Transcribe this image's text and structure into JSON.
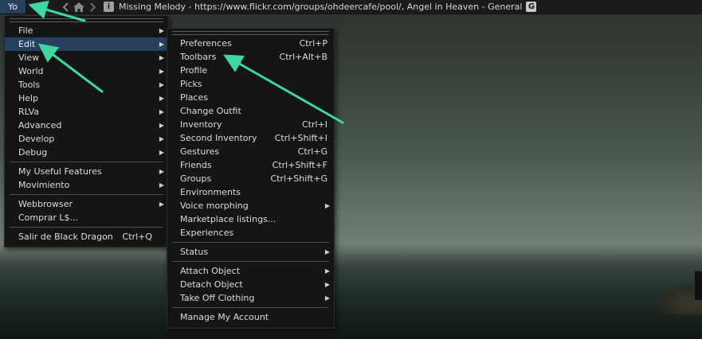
{
  "topbar": {
    "menu_label": "Yo",
    "back_icon": "back-arrow-icon",
    "forward_icon": "forward-arrow-icon",
    "home_icon": "home-icon",
    "info_icon_glyph": "i",
    "location_text": "Missing Melody - https://www.flickr.com/groups/ohdeercafe/pool/, Angel in Heaven - General",
    "rating_badge": "G"
  },
  "main_menu": {
    "items": [
      {
        "label": "File"
      },
      {
        "label": "Edit"
      },
      {
        "label": "View"
      },
      {
        "label": "World"
      },
      {
        "label": "Tools"
      },
      {
        "label": "Help"
      },
      {
        "label": "RLVa"
      },
      {
        "label": "Advanced"
      },
      {
        "label": "Develop"
      },
      {
        "label": "Debug"
      },
      {
        "label": "My Useful Features"
      },
      {
        "label": "Movimiento"
      },
      {
        "label": "Webbrowser"
      },
      {
        "label": "Comprar L$..."
      },
      {
        "label": "Salir de Black Dragon",
        "shortcut": "Ctrl+Q"
      }
    ]
  },
  "edit_menu": {
    "items": [
      {
        "label": "Preferences",
        "shortcut": "Ctrl+P"
      },
      {
        "label": "Toolbars",
        "shortcut": "Ctrl+Alt+B"
      },
      {
        "label": "Profile"
      },
      {
        "label": "Picks"
      },
      {
        "label": "Places"
      },
      {
        "label": "Change Outfit"
      },
      {
        "label": "Inventory",
        "shortcut": "Ctrl+I"
      },
      {
        "label": "Second Inventory",
        "shortcut": "Ctrl+Shift+I"
      },
      {
        "label": "Gestures",
        "shortcut": "Ctrl+G"
      },
      {
        "label": "Friends",
        "shortcut": "Ctrl+Shift+F"
      },
      {
        "label": "Groups",
        "shortcut": "Ctrl+Shift+G"
      },
      {
        "label": "Environments"
      },
      {
        "label": "Voice morphing"
      },
      {
        "label": "Marketplace listings..."
      },
      {
        "label": "Experiences"
      },
      {
        "label": "Status"
      },
      {
        "label": "Attach Object"
      },
      {
        "label": "Detach Object"
      },
      {
        "label": "Take Off Clothing"
      },
      {
        "label": "Manage My Account"
      }
    ]
  },
  "colors": {
    "highlight": "#28405f",
    "annotation_arrow": "#3fd7a0",
    "menu_background": "#151515"
  }
}
